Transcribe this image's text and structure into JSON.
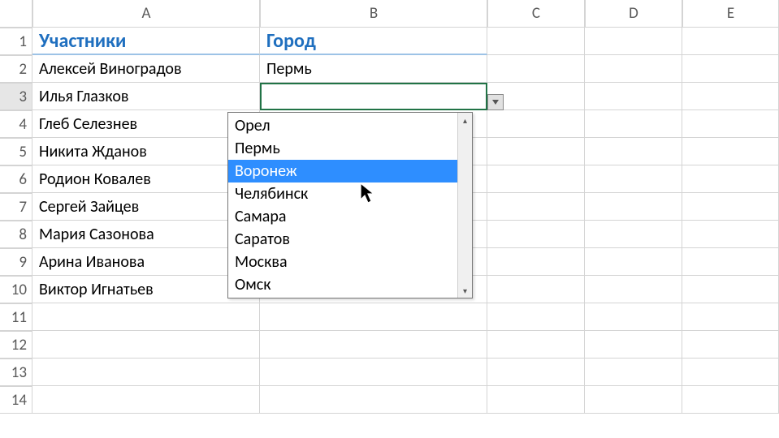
{
  "columns": [
    "A",
    "B",
    "C",
    "D",
    "E"
  ],
  "row_count": 14,
  "active_row": 3,
  "headers": {
    "A": "Участники",
    "B": "Город"
  },
  "rows": [
    {
      "A": "Алексей Виноградов",
      "B": "Пермь"
    },
    {
      "A": "Илья Глазков",
      "B": ""
    },
    {
      "A": "Глеб Селезнев",
      "B": ""
    },
    {
      "A": "Никита Жданов",
      "B": ""
    },
    {
      "A": "Родион Ковалев",
      "B": ""
    },
    {
      "A": "Сергей Зайцев",
      "B": ""
    },
    {
      "A": "Мария Сазонова",
      "B": ""
    },
    {
      "A": "Арина Иванова",
      "B": ""
    },
    {
      "A": "Виктор Игнатьев",
      "B": ""
    }
  ],
  "dropdown": {
    "items": [
      "Орел",
      "Пермь",
      "Воронеж",
      "Челябинск",
      "Самара",
      "Саратов",
      "Москва",
      "Омск"
    ],
    "hover_index": 2
  }
}
